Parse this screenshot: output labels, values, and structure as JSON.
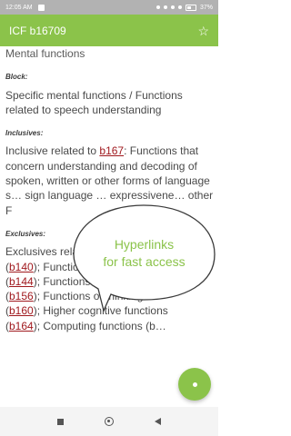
{
  "status_bar": {
    "time": "12:05 AM",
    "battery": "37%"
  },
  "app_bar": {
    "title": "ICF b16709",
    "star_icon": "star-outline-icon"
  },
  "content": {
    "section_heading": "Mental functions",
    "block_label": "Block:",
    "block_text": "Specific mental functions / Functions related to speech understanding",
    "inclusives_label": "Inclusives:",
    "inclusives_prefix": "Inclusive related to ",
    "inclusives_link": "b167",
    "inclusives_text": ": Functions that concern understanding and decoding of spoken, written or other forms of language s… sign language … expressivene… other F",
    "exclusives_label": "Exclusives:",
    "exclusives_text": "Exclusives relate… functions of attention",
    "refs": [
      {
        "code": "b140",
        "label": "); Functions of memory"
      },
      {
        "code": "b144",
        "label": "); Functions of perception"
      },
      {
        "code": "b156",
        "label": "); Functions of thinking"
      },
      {
        "code": "b160",
        "label": "); Higher cognitive functions"
      },
      {
        "code": "b164",
        "label": "); Computing functions (b…"
      }
    ]
  },
  "callout": {
    "line1": "Hyperlinks",
    "line2": "for fast access"
  },
  "colors": {
    "accent": "#8bc34a",
    "link": "#a0191e"
  }
}
